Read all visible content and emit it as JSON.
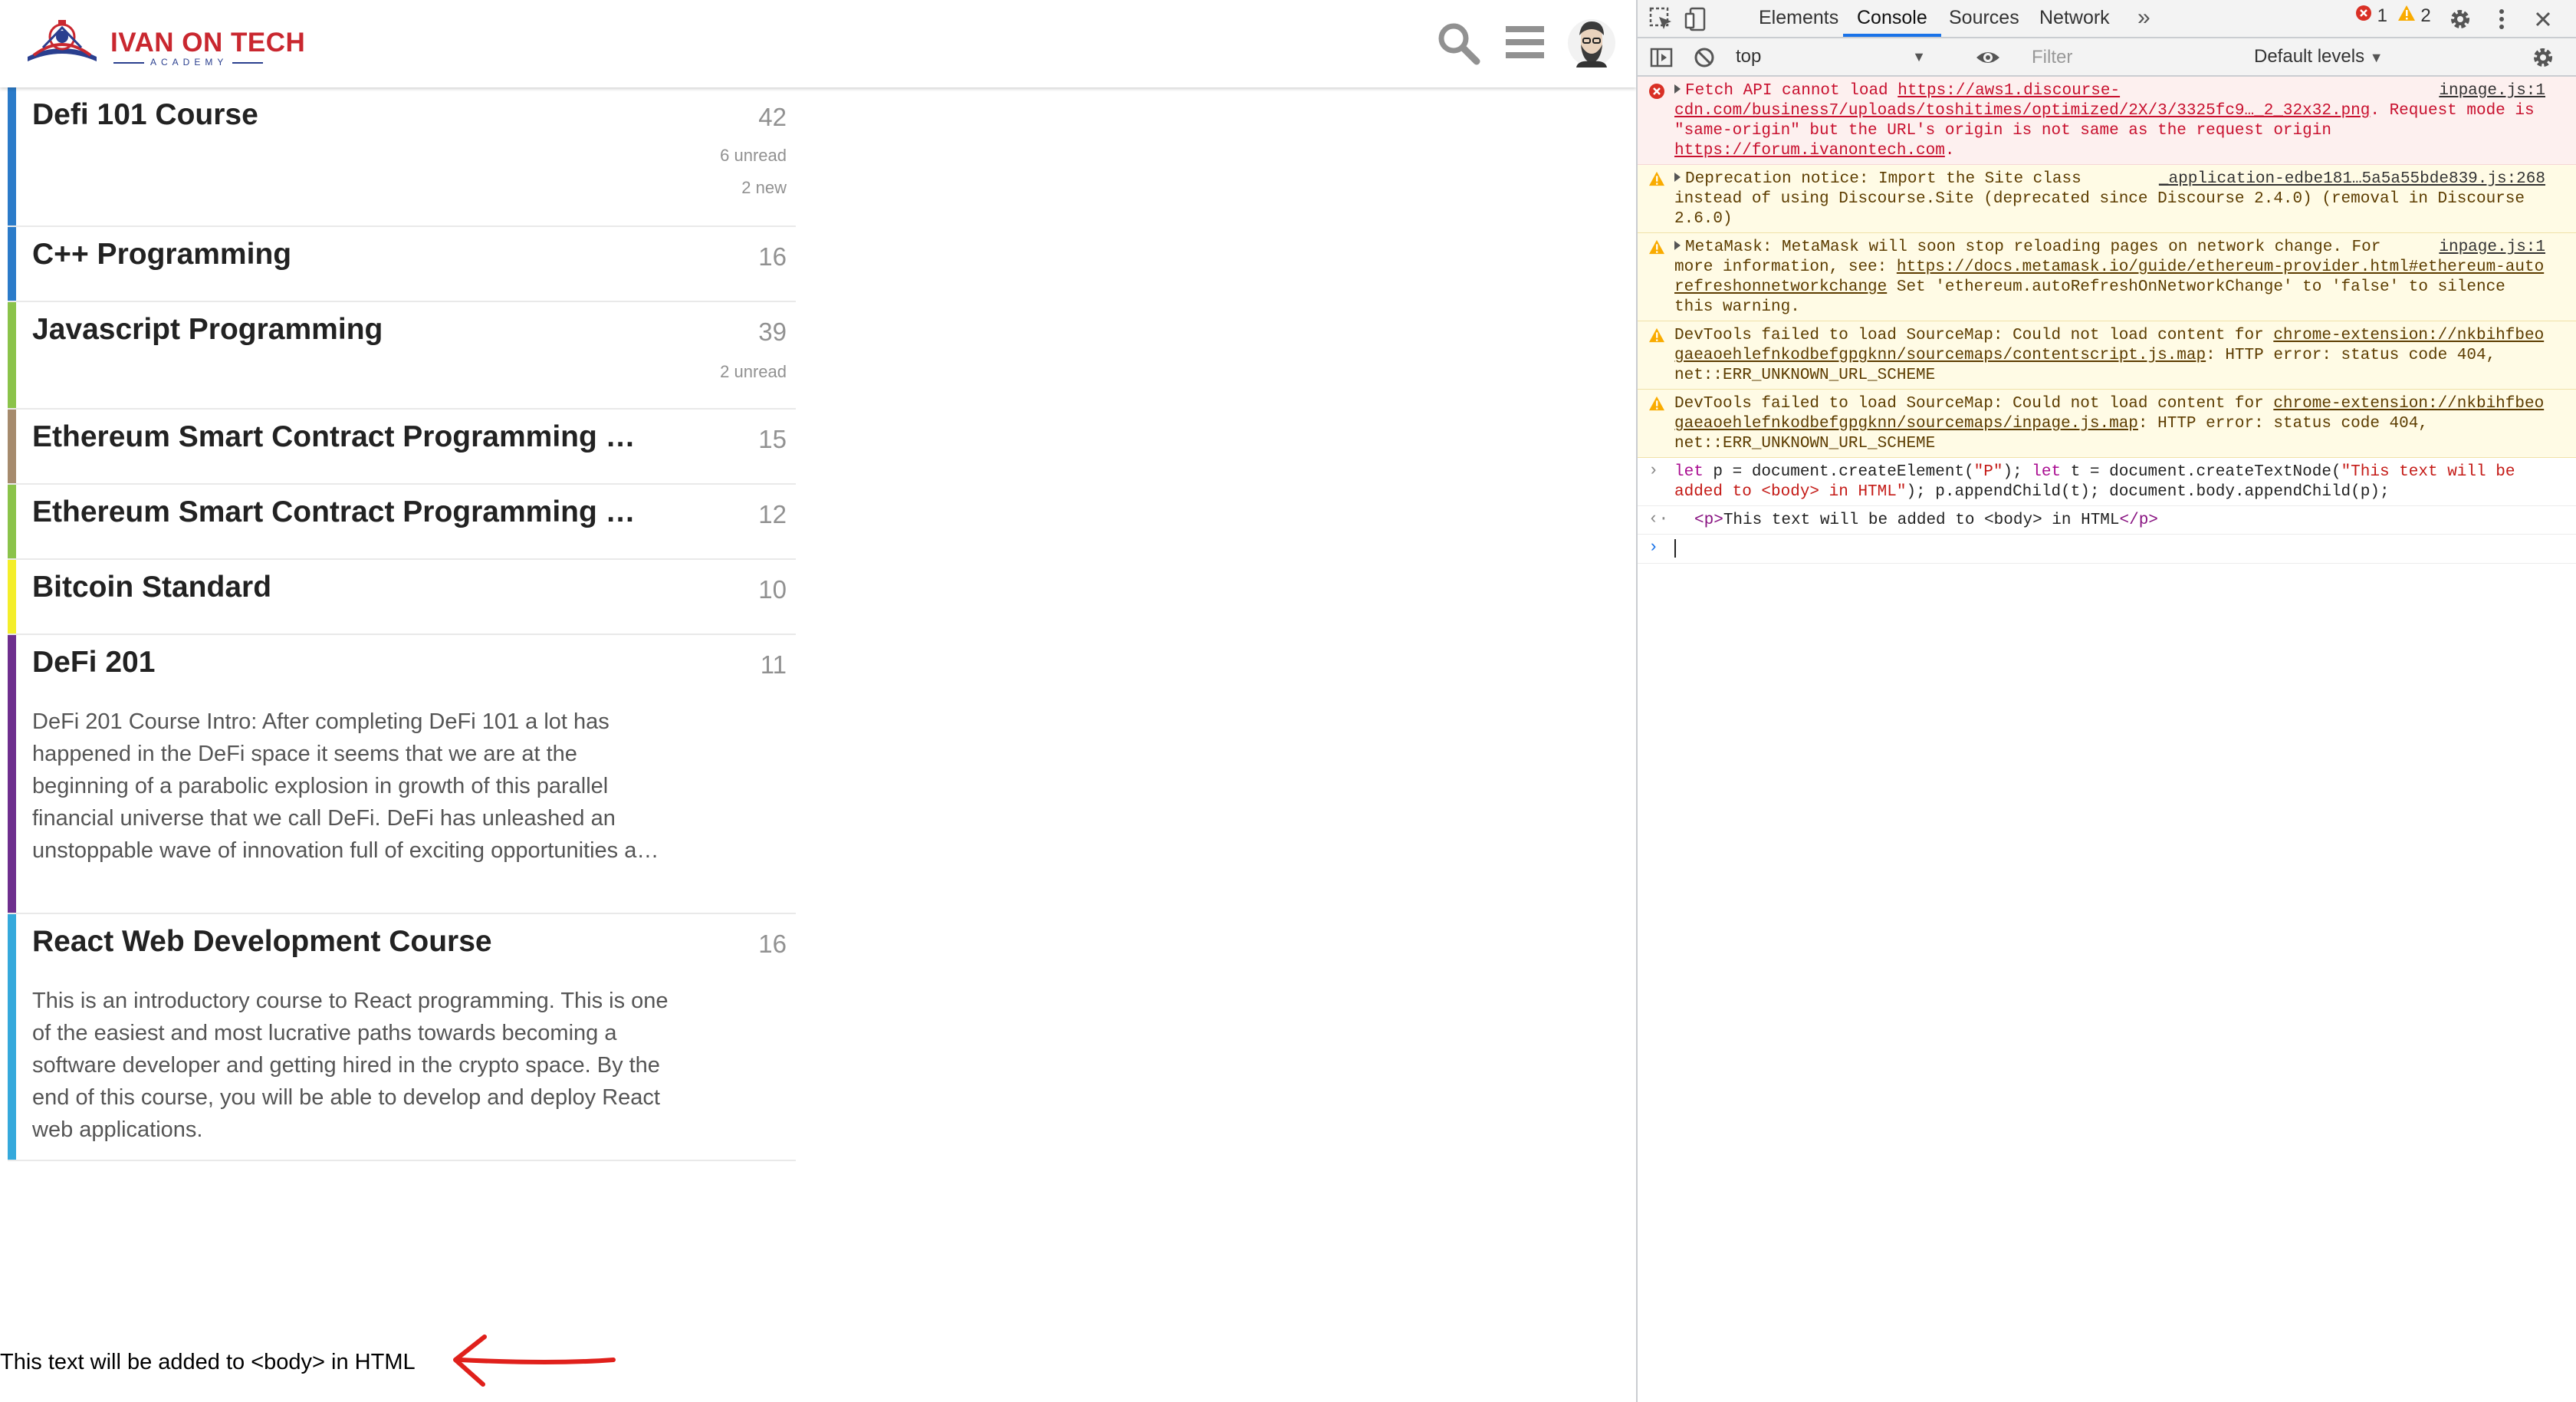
{
  "site": {
    "brand": "IVAN ON TECH",
    "brand_sub": "ACADEMY"
  },
  "categories": [
    {
      "name": "Defi 101 Course",
      "count": "42",
      "unread": "6 unread",
      "new": "2 new",
      "color": "#2b7bc9",
      "description": ""
    },
    {
      "name": "C++ Programming",
      "count": "16",
      "unread": "",
      "new": "",
      "color": "#2b7bc9",
      "description": ""
    },
    {
      "name": "Javascript Programming",
      "count": "39",
      "unread": "2 unread",
      "new": "",
      "color": "#8bc34a",
      "description": ""
    },
    {
      "name": "Ethereum Smart Contract Programming …",
      "count": "15",
      "unread": "",
      "new": "",
      "color": "#a68b6d",
      "description": ""
    },
    {
      "name": "Ethereum Smart Contract Programming …",
      "count": "12",
      "unread": "",
      "new": "",
      "color": "#8bc34a",
      "description": ""
    },
    {
      "name": "Bitcoin Standard",
      "count": "10",
      "unread": "",
      "new": "",
      "color": "#f4ee2a",
      "description": ""
    },
    {
      "name": "DeFi 201",
      "count": "11",
      "unread": "",
      "new": "",
      "color": "#6e2f8e",
      "description": "DeFi 201 Course Intro: After completing DeFi 101 a lot has happened in the DeFi space it seems that we are at the beginning of a parabolic explosion in growth of this parallel financial universe that we call DeFi. DeFi has unleashed an unstoppable wave of innovation full of exciting opportunities a…"
    },
    {
      "name": "React Web Development Course",
      "count": "16",
      "unread": "",
      "new": "",
      "color": "#35a9dc",
      "description": "This is an introductory course to React programming. This is one of the easiest and most lucrative paths towards becoming a software developer and getting hired in the crypto space. By the end of this course, you will be able to develop and deploy React web applications."
    }
  ],
  "added_text": "This text will be added to <body> in HTML",
  "devtools": {
    "tabs": [
      "Elements",
      "Console",
      "Sources",
      "Network"
    ],
    "active_tab": "Console",
    "more_tabs": "»",
    "error_count": "1",
    "warning_count": "2",
    "context": "top",
    "filter_placeholder": "Filter",
    "levels": "Default levels",
    "messages": {
      "error1_pre": "Fetch API cannot load ",
      "error1_link": "https://aws1.discourse-cdn.com/business7/uploads/toshitimes/optimized/2X/3/3325fc9…_2_32x32.png",
      "error1_mid": ". Request mode is \"same-origin\" but the URL's origin is not same as the request origin ",
      "error1_link2": "https://forum.ivanontech.com",
      "error1_end": ".",
      "error1_src": "inpage.js:1",
      "warn1_text": "Deprecation notice: Import the Site class instead of using Discourse.Site (deprecated since Discourse 2.4.0) (removal in Discourse 2.6.0)",
      "warn1_src": "_application-edbe181…5a5a55bde839.js:268",
      "warn2_pre": "MetaMask: MetaMask will soon stop reloading pages on network change. For more information, see: ",
      "warn2_link": "https://docs.metamask.io/guide/ethereum-provider.html#ethereum-autorefreshonnetworkchange",
      "warn2_end": " Set 'ethereum.autoRefreshOnNetworkChange' to 'false' to silence this warning.",
      "warn2_src": "inpage.js:1",
      "warn3_pre": "DevTools failed to load SourceMap: Could not load content for ",
      "warn3_link": "chrome-extension://nkbihfbeogaeaoehlefnkodbefgpgknn/sourcemaps/contentscript.js.map",
      "warn3_end": ": HTTP error: status code 404, net::ERR_UNKNOWN_URL_SCHEME",
      "warn4_pre": "DevTools failed to load SourceMap: Could not load content for ",
      "warn4_link": "chrome-extension://nkbihfbeogaeaoehlefnkodbefgpgknn/sourcemaps/inpage.js.map",
      "warn4_end": ": HTTP error: status code 404, net::ERR_UNKNOWN_URL_SCHEME",
      "input_kw1": "let",
      "input_a": " p = document.createElement(",
      "input_s1": "\"P\"",
      "input_b": "); ",
      "input_kw2": "let",
      "input_c": " t = document.createTextNode(",
      "input_s2": "\"This text will be added to <body> in HTML\"",
      "input_d": "); p.appendChild(t); document.body.appendChild(p);",
      "result_open": "<p>",
      "result_text": "This text will be added to <body> in HTML",
      "result_close": "</p>"
    }
  }
}
